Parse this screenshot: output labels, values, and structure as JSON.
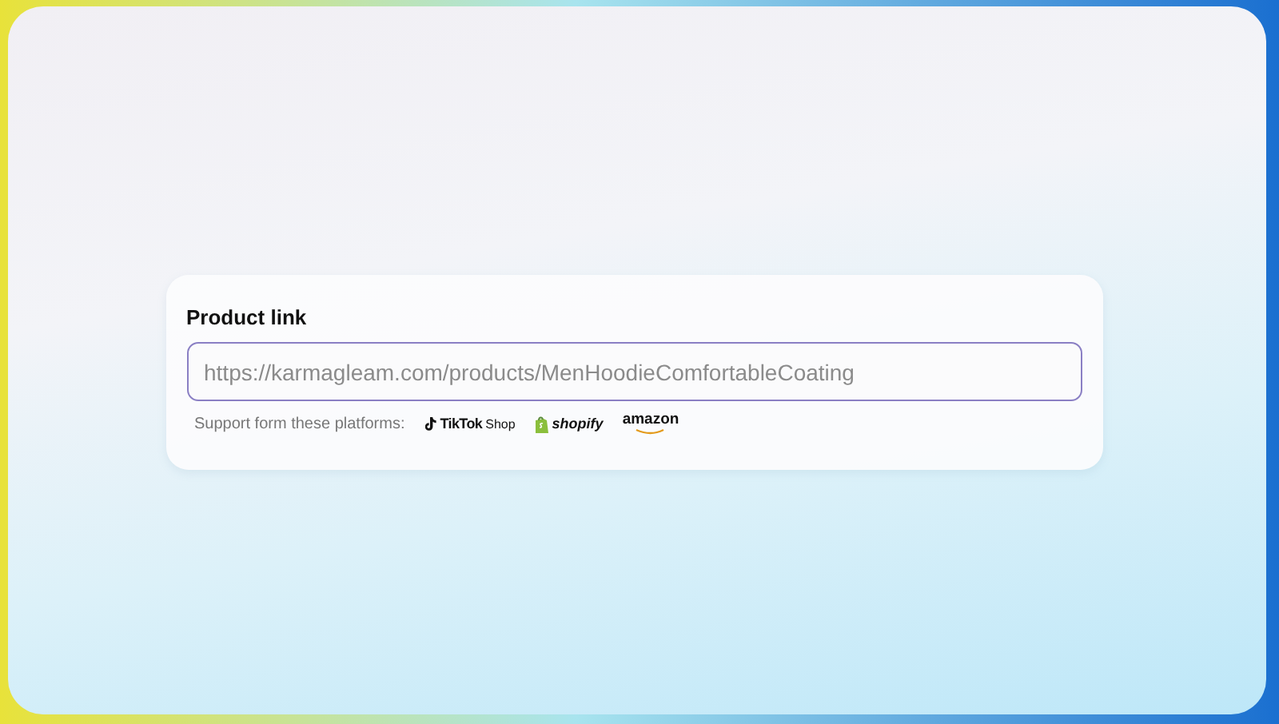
{
  "form": {
    "label": "Product link",
    "link_field": {
      "placeholder": "https://karmagleam.com/products/MenHoodieComfortableCoating"
    },
    "platforms_note": "Support form these platforms:",
    "platforms": [
      {
        "kind": "tiktok",
        "name": "TikTok",
        "suffix": "Shop"
      },
      {
        "kind": "shopify",
        "name": "shopify"
      },
      {
        "kind": "amazon",
        "name": "amazon"
      }
    ]
  }
}
